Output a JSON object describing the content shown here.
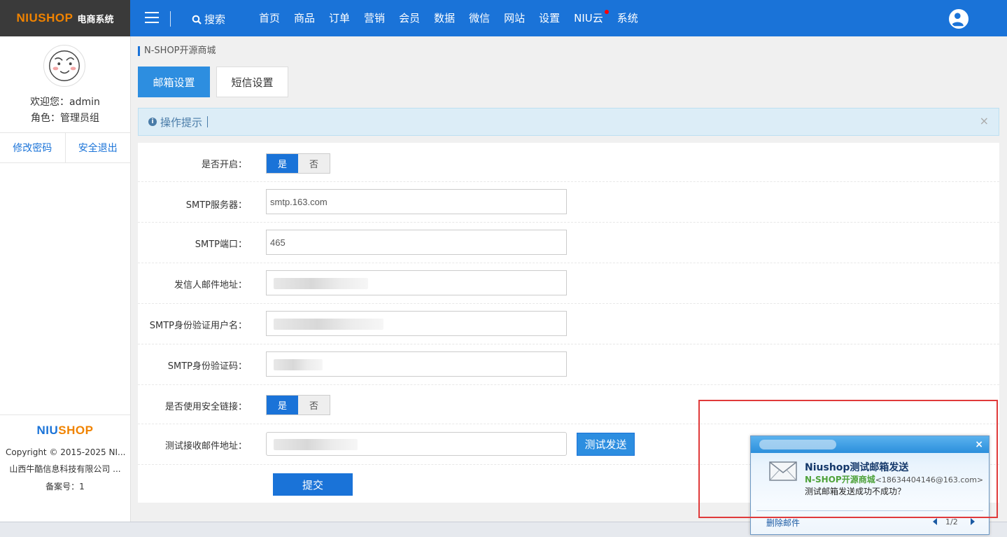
{
  "brand": {
    "logo_text": "NIUSHOP",
    "logo_sub": "电商系统",
    "footer_logo_a": "NIU",
    "footer_logo_b": "SHOP"
  },
  "topbar": {
    "search_label": "搜索",
    "nav": [
      "首页",
      "商品",
      "订单",
      "营销",
      "会员",
      "数据",
      "微信",
      "网站",
      "设置",
      "NIU云",
      "系统"
    ]
  },
  "sidebar": {
    "welcome": "欢迎您：admin",
    "role": "角色：管理员组",
    "change_password": "修改密码",
    "logout": "安全退出",
    "copyright": "Copyright © 2015-2025 NI...",
    "company": "山西牛酷信息科技有限公司 ...",
    "icp": "备案号：1"
  },
  "main": {
    "breadcrumb": "N-SHOP开源商城",
    "tabs": [
      "邮箱设置",
      "短信设置"
    ],
    "tips_label": "操作提示",
    "tips_close": "×"
  },
  "form": {
    "enabled_label": "是否开启：",
    "yes": "是",
    "no": "否",
    "smtp_server_label": "SMTP服务器：",
    "smtp_server_value": "smtp.163.com",
    "smtp_port_label": "SMTP端口：",
    "smtp_port_value": "465",
    "sender_label": "发信人邮件地址：",
    "auth_user_label": "SMTP身份验证用户名：",
    "auth_code_label": "SMTP身份验证码：",
    "secure_label": "是否使用安全链接：",
    "test_addr_label": "测试接收邮件地址：",
    "test_button": "测试发送",
    "submit_button": "提交"
  },
  "popup": {
    "title": "Niushop测试邮箱发送",
    "sender": "N-SHOP开源商城",
    "address": "<18634404146@163.com>",
    "body": "测试邮箱发送成功不成功？",
    "delete": "删除邮件",
    "page": "1/2",
    "close": "×"
  },
  "colors": {
    "primary": "#1a73d8",
    "brand_orange": "#f08300",
    "highlight_red": "#e03a3a"
  }
}
